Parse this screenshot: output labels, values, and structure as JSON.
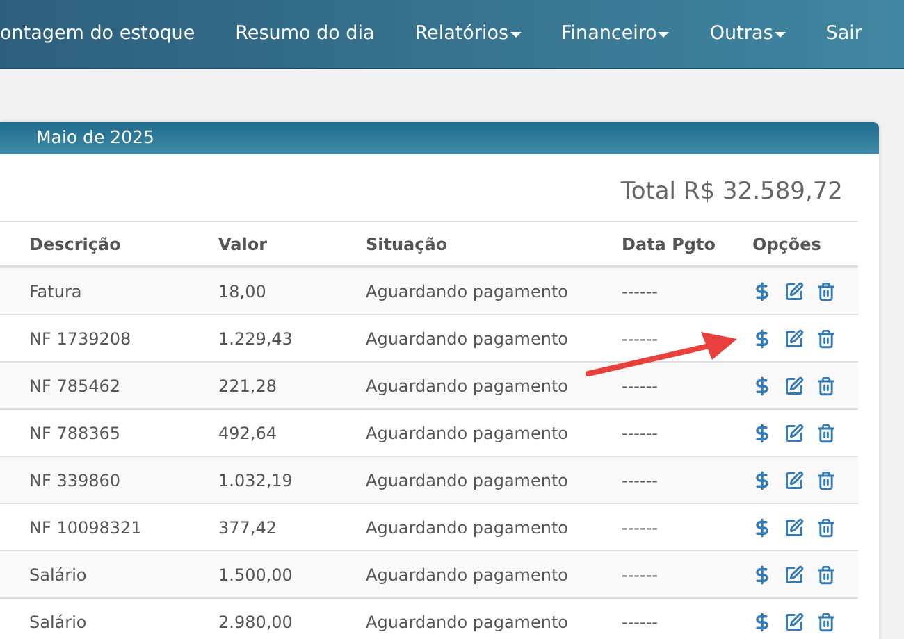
{
  "navbar": {
    "items": [
      {
        "label": "ontagem do estoque",
        "dropdown": false
      },
      {
        "label": "Resumo do dia",
        "dropdown": false
      },
      {
        "label": "Relatórios",
        "dropdown": true
      },
      {
        "label": "Financeiro",
        "dropdown": true
      },
      {
        "label": "Outras",
        "dropdown": true
      },
      {
        "label": "Sair",
        "dropdown": false
      }
    ]
  },
  "panel": {
    "title": "Maio de 2025",
    "total": "Total R$ 32.589,72"
  },
  "table": {
    "columns": [
      "Descrição",
      "Valor",
      "Situação",
      "Data Pgto",
      "Opções"
    ],
    "rows": [
      {
        "descricao": "Fatura",
        "valor": "18,00",
        "situacao": "Aguardando pagamento",
        "data_pgto": "------"
      },
      {
        "descricao": "NF 1739208",
        "valor": "1.229,43",
        "situacao": "Aguardando pagamento",
        "data_pgto": "------"
      },
      {
        "descricao": "NF 785462",
        "valor": "221,28",
        "situacao": "Aguardando pagamento",
        "data_pgto": "------"
      },
      {
        "descricao": "NF 788365",
        "valor": "492,64",
        "situacao": "Aguardando pagamento",
        "data_pgto": "------"
      },
      {
        "descricao": "NF 339860",
        "valor": "1.032,19",
        "situacao": "Aguardando pagamento",
        "data_pgto": "------"
      },
      {
        "descricao": "NF 10098321",
        "valor": "377,42",
        "situacao": "Aguardando pagamento",
        "data_pgto": "------"
      },
      {
        "descricao": "Salário",
        "valor": "1.500,00",
        "situacao": "Aguardando pagamento",
        "data_pgto": "------"
      },
      {
        "descricao": "Salário",
        "valor": "2.980,00",
        "situacao": "Aguardando pagamento",
        "data_pgto": "------"
      }
    ]
  }
}
